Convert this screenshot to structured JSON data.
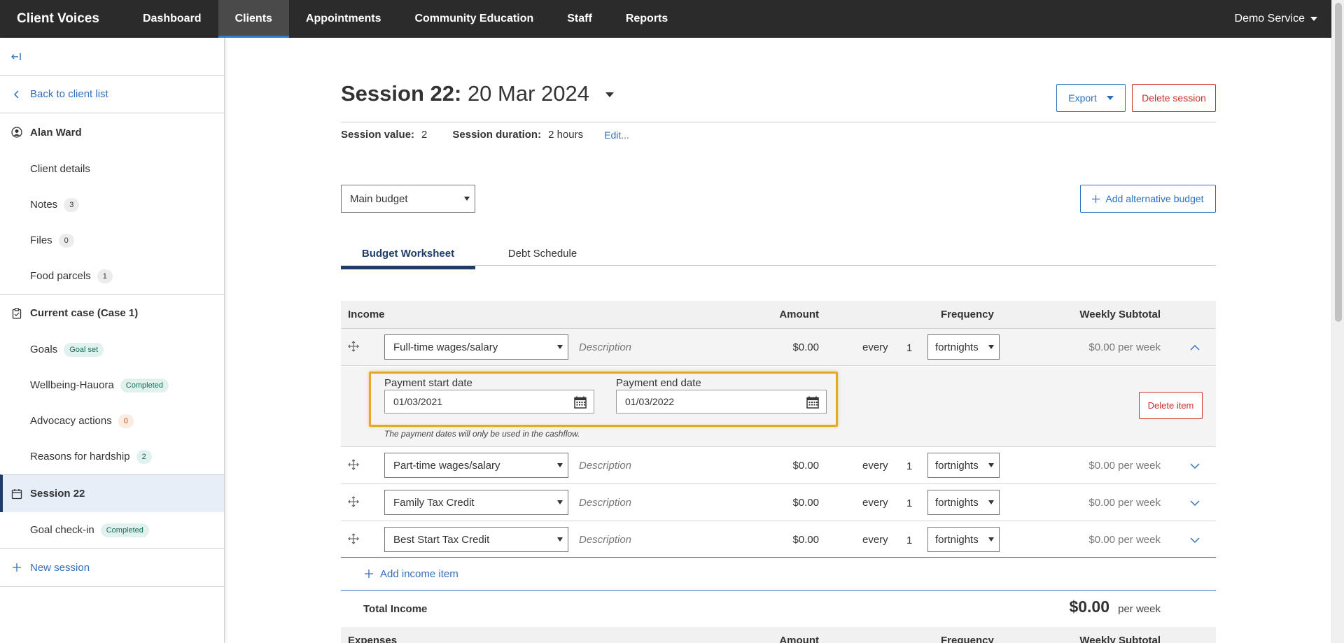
{
  "app": {
    "brand": "Client Voices",
    "nav": [
      "Dashboard",
      "Clients",
      "Appointments",
      "Community Education",
      "Staff",
      "Reports"
    ],
    "active_nav": "Clients",
    "service": "Demo Service"
  },
  "sidebar": {
    "collapse_icon": "collapse-left-icon",
    "back": "Back to client list",
    "client_name": "Alan Ward",
    "client_items": [
      {
        "label": "Client details",
        "badge": ""
      },
      {
        "label": "Notes",
        "badge": "3"
      },
      {
        "label": "Files",
        "badge": "0"
      },
      {
        "label": "Food parcels",
        "badge": "1"
      }
    ],
    "case_title": "Current case (Case 1)",
    "case_items": [
      {
        "label": "Goals",
        "badge": "Goal set"
      },
      {
        "label": "Wellbeing-Hauora",
        "badge": "Completed"
      },
      {
        "label": "Advocacy actions",
        "badge": "0"
      },
      {
        "label": "Reasons for hardship",
        "badge": "2"
      }
    ],
    "session_title": "Session 22",
    "session_items": [
      {
        "label": "Goal check-in",
        "badge": "Completed"
      }
    ],
    "new_session": "New session"
  },
  "session": {
    "title_bold": "Session 22:",
    "title_date": "20 Mar 2024",
    "export_label": "Export",
    "delete_label": "Delete session",
    "value_label": "Session value:",
    "value": "2",
    "duration_label": "Session duration:",
    "duration": "2 hours",
    "edit_label": "Edit..."
  },
  "budget": {
    "selected": "Main budget",
    "add_alt_label": "Add alternative budget",
    "tabs": [
      "Budget Worksheet",
      "Debt Schedule"
    ],
    "active_tab": "Budget Worksheet"
  },
  "income": {
    "headers": {
      "category": "Income",
      "amount": "Amount",
      "frequency": "Frequency",
      "weekly": "Weekly Subtotal"
    },
    "rows": [
      {
        "type": "Full-time wages/salary",
        "description_placeholder": "Description",
        "amount": "$0.00",
        "every": "every",
        "count": "1",
        "frequency": "fortnights",
        "weekly": "$0.00 per week",
        "expanded": true
      },
      {
        "type": "Part-time wages/salary",
        "description_placeholder": "Description",
        "amount": "$0.00",
        "every": "every",
        "count": "1",
        "frequency": "fortnights",
        "weekly": "$0.00 per week",
        "expanded": false
      },
      {
        "type": "Family Tax Credit",
        "description_placeholder": "Description",
        "amount": "$0.00",
        "every": "every",
        "count": "1",
        "frequency": "fortnights",
        "weekly": "$0.00 per week",
        "expanded": false
      },
      {
        "type": "Best Start Tax Credit",
        "description_placeholder": "Description",
        "amount": "$0.00",
        "every": "every",
        "count": "1",
        "frequency": "fortnights",
        "weekly": "$0.00 per week",
        "expanded": false
      }
    ],
    "detail": {
      "start_label": "Payment start date",
      "start_value": "01/03/2021",
      "end_label": "Payment end date",
      "end_value": "01/03/2022",
      "hint": "The payment dates will only be used in the cashflow.",
      "delete_label": "Delete item"
    },
    "add_label": "Add income item",
    "total_label": "Total Income",
    "total_value": "$0.00",
    "total_unit": "per week"
  },
  "expenses": {
    "headers": {
      "category": "Expenses",
      "amount": "Amount",
      "frequency": "Frequency",
      "weekly": "Weekly Subtotal"
    }
  },
  "colors": {
    "nav_bg": "#2b2b2b",
    "accent": "#2f6fba",
    "danger": "#c9302c",
    "highlight": "#e6a726",
    "active_tab": "#1d3c6b"
  }
}
